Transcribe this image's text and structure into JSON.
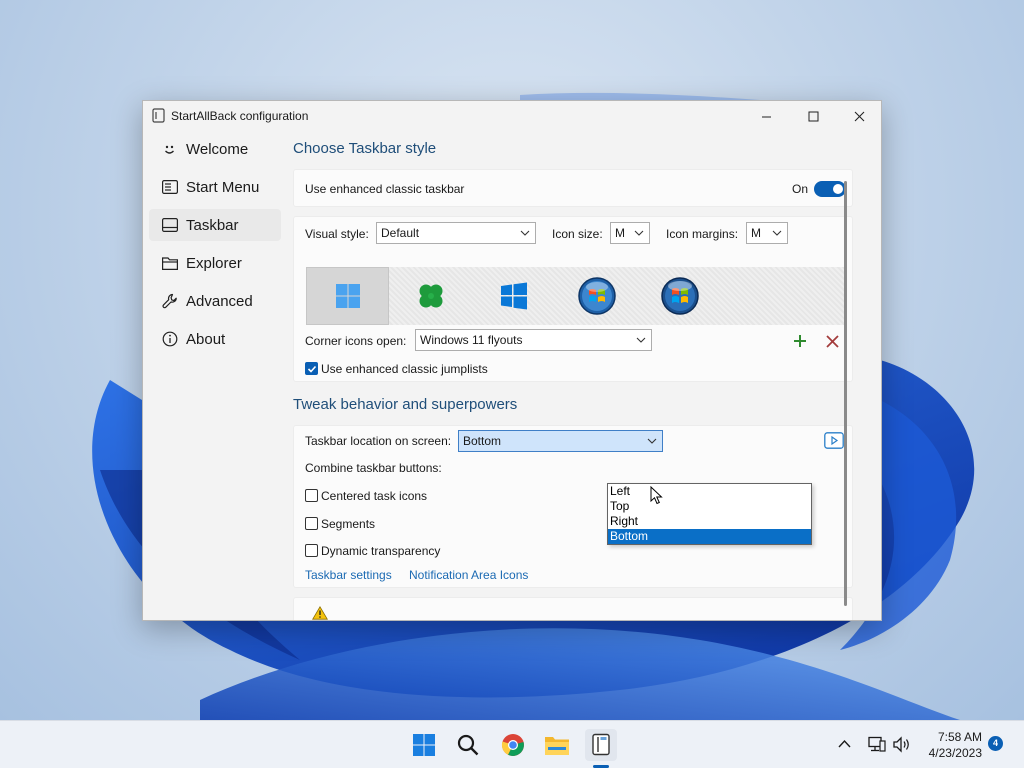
{
  "window": {
    "title": "StartAllBack configuration"
  },
  "sidebar": {
    "items": [
      {
        "label": "Welcome",
        "icon": "smiley-icon"
      },
      {
        "label": "Start Menu",
        "icon": "start-menu-icon"
      },
      {
        "label": "Taskbar",
        "icon": "taskbar-icon",
        "active": true
      },
      {
        "label": "Explorer",
        "icon": "folder-icon"
      },
      {
        "label": "Advanced",
        "icon": "wrench-icon"
      },
      {
        "label": "About",
        "icon": "info-icon"
      }
    ]
  },
  "taskbar_style": {
    "heading": "Choose Taskbar style",
    "enhanced_label": "Use enhanced classic taskbar",
    "toggle_state": "On",
    "visual_style_label": "Visual style:",
    "visual_style_value": "Default",
    "icon_size_label": "Icon size:",
    "icon_size_value": "M",
    "icon_margins_label": "Icon margins:",
    "icon_margins_value": "M",
    "styles": [
      "windows-11-icon",
      "clover-icon",
      "windows-10-icon",
      "windows-7-orb-icon",
      "windows-vista-orb-icon"
    ],
    "corner_icons_label": "Corner icons open:",
    "corner_icons_value": "Windows 11 flyouts",
    "jumplists_label": "Use enhanced classic jumplists",
    "jumplists_checked": true
  },
  "tweaks": {
    "heading": "Tweak behavior and superpowers",
    "location_label": "Taskbar location on screen:",
    "location_value": "Bottom",
    "location_options": [
      "Left",
      "Top",
      "Right",
      "Bottom"
    ],
    "location_highlighted": "Bottom",
    "combine_label": "Combine taskbar buttons:",
    "centered_label": "Centered task icons",
    "segments_label": "Segments",
    "transparency_label": "Dynamic transparency",
    "link_taskbar_settings": "Taskbar settings",
    "link_notification_icons": "Notification Area Icons"
  },
  "taskbar": {
    "apps": [
      "windows-start-icon",
      "search-icon",
      "chrome-icon",
      "file-explorer-icon",
      "startallback-icon"
    ],
    "time": "7:58 AM",
    "date": "4/23/2023",
    "notification_count": "4"
  },
  "colors": {
    "accent": "#0a5fb4",
    "heading": "#1f4e79",
    "link": "#1b6ab3",
    "add": "#2e8b2e",
    "remove": "#a33b3b"
  }
}
